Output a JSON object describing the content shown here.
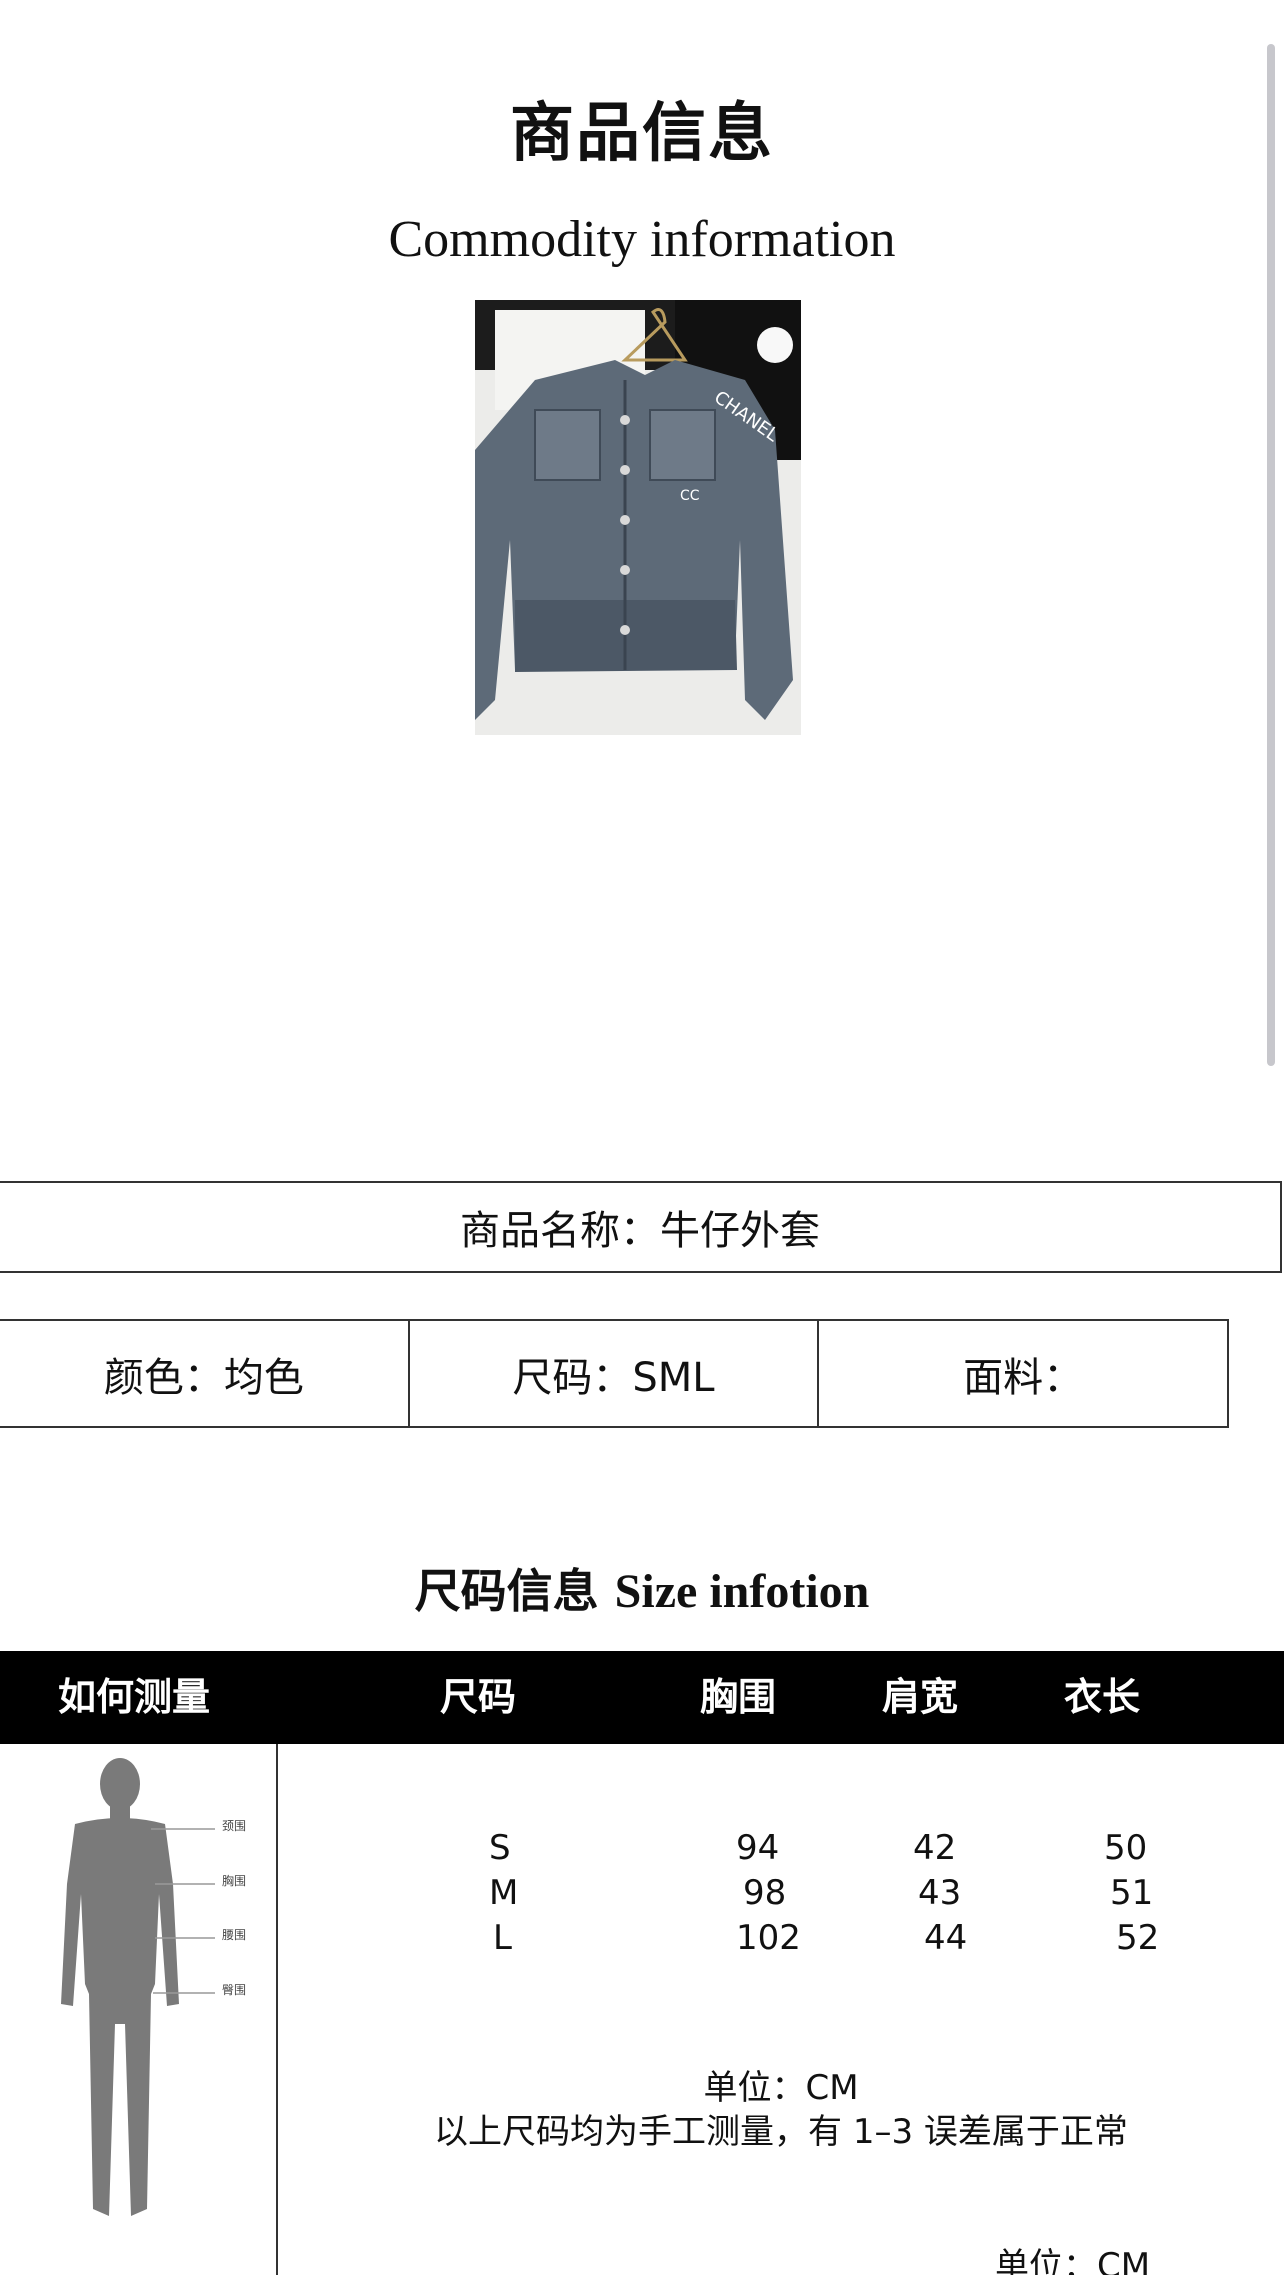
{
  "header": {
    "title_cn": "商品信息",
    "title_en": "Commodity information"
  },
  "product_photo": {
    "brand_text": "CHANEL",
    "alt": "denim jacket"
  },
  "product": {
    "name_label": "商品名称：牛仔外套",
    "color_label": "颜色：均色",
    "size_label": "尺码：SML",
    "fabric_label": "面料："
  },
  "size_info": {
    "title_cn": "尺码信息",
    "title_en": "Size infotion",
    "columns": [
      "如何测量",
      "尺码",
      "胸围",
      "肩宽",
      "衣长"
    ],
    "rows": [
      {
        "size": "S",
        "chest": "94",
        "shoulder": "42",
        "length": "50"
      },
      {
        "size": "M",
        "chest": "98",
        "shoulder": "43",
        "length": "51"
      },
      {
        "size": "L",
        "chest": "102",
        "shoulder": "44",
        "length": "52"
      }
    ],
    "figure_labels": [
      "颈围",
      "胸围",
      "腰围",
      "臀围"
    ],
    "unit_note": "单位：CM",
    "error_note": "以上尺码均为手工测量，有 1–3 误差属于正常",
    "unit_note_bottom": "单位：CM"
  }
}
